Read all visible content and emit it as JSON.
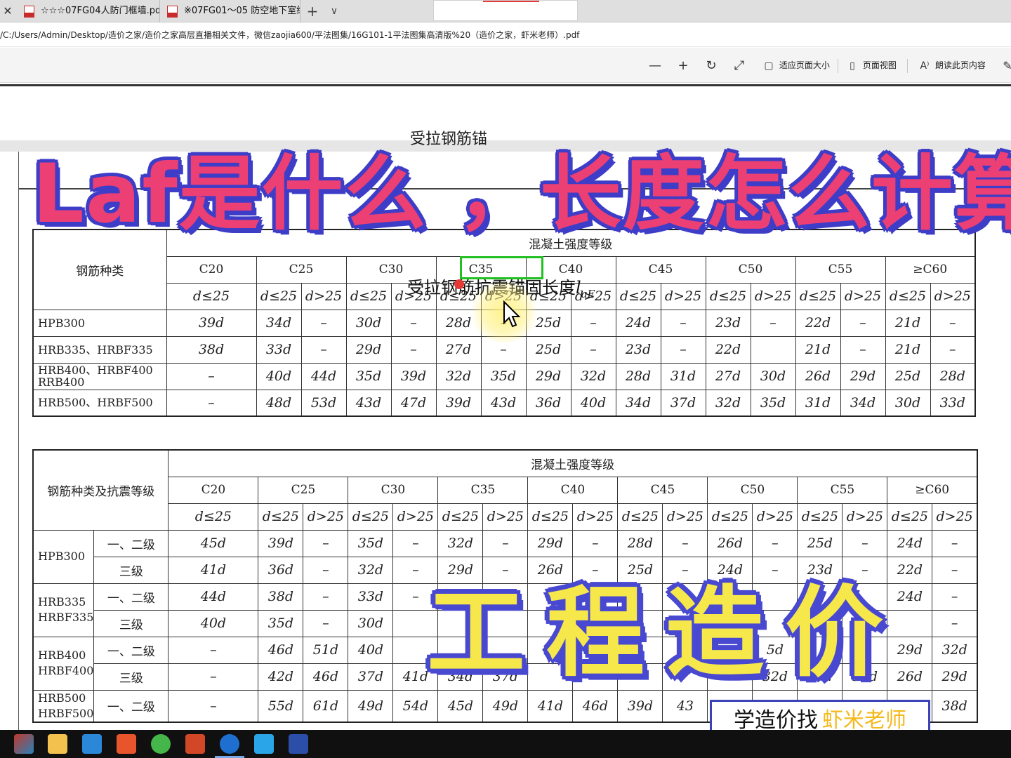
{
  "tabs": [
    {
      "label": "☆☆☆07FG04人防门框墙.pd"
    },
    {
      "label": "※07FG01～05 防空地下室结"
    }
  ],
  "tab_controls": {
    "close": "✕",
    "new_tab": "+",
    "dropdown": "∨"
  },
  "address": {
    "url": "/C:/Users/Admin/Desktop/造价之家/造价之家高层直播相关文件，微信zaojia600/平法图集/16G101-1平法图集高清版%20（造价之家，虾米老师）.pdf"
  },
  "pdf_toolbar": {
    "zoom_out_icon": "minus-icon",
    "zoom_in_icon": "plus-icon",
    "rotate_icon": "rotate-icon",
    "fullscreen_icon": "expand-icon",
    "fit_page_label": "适应页面大小",
    "page_view_label": "页面视图",
    "read_aloud_label": "朗读此页内容"
  },
  "table1": {
    "title": "受拉钢筋锚",
    "row_header": "钢筋种类",
    "group_header": "混凝土强度等级",
    "grades": [
      "C20",
      "C25",
      "C30",
      "C35",
      "C40",
      "C45",
      "C50",
      "C55",
      "≥C60"
    ],
    "first_sub": "d≤25",
    "sub_le": "d≤25",
    "sub_gt": "d>25",
    "rows": [
      {
        "label": "HPB300",
        "values": [
          "39d",
          "34d",
          "–",
          "30d",
          "–",
          "28d",
          "–",
          "25d",
          "–",
          "24d",
          "–",
          "23d",
          "–",
          "22d",
          "–",
          "21d",
          "–"
        ]
      },
      {
        "label": "HRB335、HRBF335",
        "values": [
          "38d",
          "33d",
          "–",
          "29d",
          "–",
          "27d",
          "–",
          "25d",
          "–",
          "23d",
          "–",
          "22d",
          "",
          "21d",
          "–",
          "21d",
          "–"
        ]
      },
      {
        "label": "HRB400、HRBF400\nRRB400",
        "values": [
          "–",
          "40d",
          "44d",
          "35d",
          "39d",
          "32d",
          "35d",
          "29d",
          "32d",
          "28d",
          "31d",
          "27d",
          "30d",
          "26d",
          "29d",
          "25d",
          "28d"
        ]
      },
      {
        "label": "HRB500、HRBF500",
        "values": [
          "–",
          "48d",
          "53d",
          "43d",
          "47d",
          "39d",
          "43d",
          "36d",
          "40d",
          "34d",
          "37d",
          "32d",
          "35d",
          "31d",
          "34d",
          "30d",
          "33d"
        ]
      }
    ]
  },
  "table2": {
    "title": "受拉钢筋抗震锚固长度",
    "title_symbol": "l",
    "title_subscript": "aE",
    "row_header": "钢筋种类及抗震等级",
    "group_header": "混凝土强度等级",
    "grades": [
      "C20",
      "C25",
      "C30",
      "C35",
      "C40",
      "C45",
      "C50",
      "C55",
      "≥C60"
    ],
    "first_sub": "d≤25",
    "sub_le": "d≤25",
    "sub_gt": "d>25",
    "groups": [
      {
        "label": "HPB300",
        "rows": [
          {
            "level": "一、二级",
            "values": [
              "45d",
              "39d",
              "–",
              "35d",
              "–",
              "32d",
              "–",
              "29d",
              "–",
              "28d",
              "–",
              "26d",
              "–",
              "25d",
              "–",
              "24d",
              "–"
            ]
          },
          {
            "level": "三级",
            "values": [
              "41d",
              "36d",
              "–",
              "32d",
              "–",
              "29d",
              "–",
              "26d",
              "–",
              "25d",
              "–",
              "24d",
              "–",
              "23d",
              "–",
              "22d",
              "–"
            ]
          }
        ]
      },
      {
        "label": "HRB335\nHRBF335",
        "rows": [
          {
            "level": "一、二级",
            "values": [
              "44d",
              "38d",
              "–",
              "33d",
              "–",
              "",
              "",
              "",
              "",
              "",
              "",
              "",
              "",
              "",
              "",
              "24d",
              "–"
            ]
          },
          {
            "level": "三级",
            "values": [
              "40d",
              "35d",
              "–",
              "30d",
              "",
              "",
              "",
              "",
              "",
              "",
              "",
              "",
              "",
              "",
              "",
              "",
              "–"
            ]
          }
        ]
      },
      {
        "label": "HRB400\nHRBF400",
        "rows": [
          {
            "level": "一、二级",
            "values": [
              "–",
              "46d",
              "51d",
              "40d",
              "",
              "",
              "",
              "",
              "",
              "",
              "",
              "",
              "5d",
              "",
              "",
              "29d",
              "32d"
            ]
          },
          {
            "level": "三级",
            "values": [
              "–",
              "42d",
              "46d",
              "37d",
              "41d",
              "34d",
              "37d",
              "",
              "",
              "",
              "",
              "",
              "32d",
              "27d",
              "30d",
              "26d",
              "29d"
            ]
          }
        ]
      },
      {
        "label": "HRB500\nHRBF500",
        "rows": [
          {
            "level": "一、二级",
            "values": [
              "–",
              "55d",
              "61d",
              "49d",
              "54d",
              "45d",
              "49d",
              "41d",
              "46d",
              "39d",
              "43",
              "",
              "",
              "",
              "",
              "d",
              "38d"
            ]
          }
        ]
      }
    ]
  },
  "overlay": {
    "title": "Laf是什么 ，长度怎么计算",
    "subtitle": "工程造价",
    "brand_prefix": "学造价找",
    "brand_name": "虾米老师"
  },
  "colors": {
    "overlay_title": "#ec3f73",
    "overlay_outline": "#3d3dc8",
    "overlay_sub": "#f6e84a",
    "brand_name": "#f4b91c",
    "highlight": "#21c021"
  },
  "taskbar_apps": [
    "start-icon",
    "file-explorer-icon",
    "store-icon",
    "video-app-icon",
    "browser-green-icon",
    "powerpoint-icon",
    "edge-icon",
    "text-app-icon",
    "cad-icon"
  ]
}
